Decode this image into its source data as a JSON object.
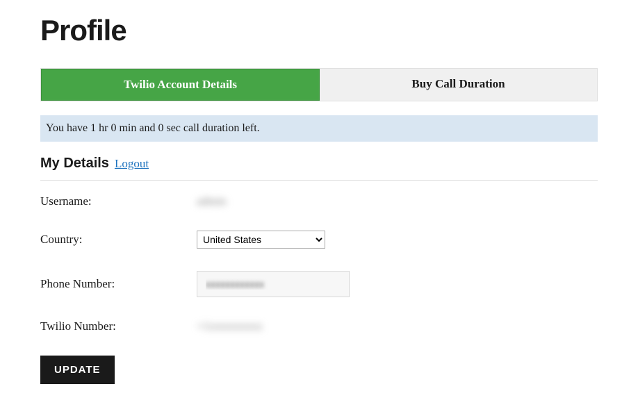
{
  "page": {
    "title": "Profile"
  },
  "tabs": {
    "account": "Twilio Account Details",
    "buy": "Buy Call Duration"
  },
  "info_bar": "You have 1 hr 0 min and 0 sec call duration left.",
  "section": {
    "title": "My Details",
    "logout": "Logout"
  },
  "form": {
    "username_label": "Username:",
    "username_value": "admin",
    "country_label": "Country:",
    "country_value": "United States",
    "phone_label": "Phone Number:",
    "phone_value": "xxxxxxxxxxxx",
    "twilio_label": "Twilio Number:",
    "twilio_value": "+1xxxxxxxxx"
  },
  "buttons": {
    "update": "UPDATE"
  }
}
